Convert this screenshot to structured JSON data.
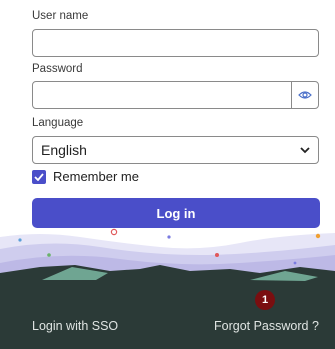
{
  "form": {
    "username_label": "User name",
    "username_value": "",
    "password_label": "Password",
    "password_value": "",
    "language_label": "Language",
    "language_selected": "English",
    "remember_label": "Remember me",
    "remember_checked": true,
    "login_label": "Log in"
  },
  "footer": {
    "sso_label": "Login with SSO",
    "forgot_label": "Forgot Password ?",
    "badge_count": "1"
  },
  "colors": {
    "primary": "#4a4ec9",
    "footer_bg": "#2b3a37",
    "badge": "#7a0e10"
  }
}
